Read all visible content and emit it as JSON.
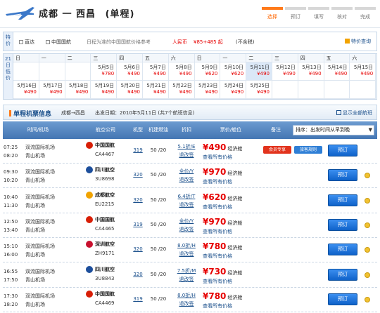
{
  "header": {
    "route": "成都 一 西昌",
    "trip_type": "(单程)",
    "steps": [
      "选择",
      "预订",
      "填写",
      "核对",
      "完成"
    ]
  },
  "filter": {
    "side_label": "特价",
    "direct": "直达",
    "airline": "中国国航",
    "hint": "日程为准的中国国航价格参考",
    "price_label": "人民币",
    "price_value": "¥85+485 起",
    "tax_note": "(不含税)",
    "calendar_link": "特价查询"
  },
  "calendar": {
    "side_label": "21日低价",
    "weekdays": [
      "日",
      "一",
      "二",
      "三",
      "四",
      "五",
      "六",
      "日",
      "一",
      "二",
      "三",
      "四",
      "五",
      "六"
    ],
    "row1": [
      {
        "date": "",
        "price": ""
      },
      {
        "date": "",
        "price": ""
      },
      {
        "date": "",
        "price": ""
      },
      {
        "date": "5月5日",
        "price": "¥780"
      },
      {
        "date": "5月6日",
        "price": "¥490"
      },
      {
        "date": "5月7日",
        "price": "¥490"
      },
      {
        "date": "5月8日",
        "price": "¥490"
      },
      {
        "date": "5月9日",
        "price": "¥620"
      },
      {
        "date": "5月10日",
        "price": "¥620"
      },
      {
        "date": "5月11日",
        "price": "¥490"
      },
      {
        "date": "5月12日",
        "price": "¥490"
      },
      {
        "date": "5月13日",
        "price": "¥490"
      },
      {
        "date": "5月14日",
        "price": "¥490"
      },
      {
        "date": "5月15日",
        "price": "¥490"
      }
    ],
    "row2": [
      {
        "date": "5月16日",
        "price": "¥490"
      },
      {
        "date": "5月17日",
        "price": "¥490"
      },
      {
        "date": "5月18日",
        "price": "¥490"
      },
      {
        "date": "5月19日",
        "price": "¥490"
      },
      {
        "date": "5月20日",
        "price": "¥490"
      },
      {
        "date": "5月21日",
        "price": "¥490"
      },
      {
        "date": "5月22日",
        "price": "¥490"
      },
      {
        "date": "5月23日",
        "price": "¥490"
      },
      {
        "date": "5月24日",
        "price": "¥490"
      },
      {
        "date": "5月25日",
        "price": "¥490"
      },
      {
        "date": "",
        "price": ""
      },
      {
        "date": "",
        "price": ""
      },
      {
        "date": "",
        "price": ""
      },
      {
        "date": "",
        "price": ""
      }
    ]
  },
  "info": {
    "title": "单程机票信息",
    "route": "成都→西昌",
    "date": "出发日期：2010年5月11日 (共7个航班信息)",
    "show_all": "显示全部航班"
  },
  "table": {
    "headers": [
      "时间/机场",
      "航空公司",
      "机型",
      "机建燃油",
      "折扣",
      "票价/舱位",
      "备注"
    ],
    "sort_label": "排序：出发时间从早到晚",
    "rows": [
      {
        "dep": "07:25",
        "arr": "08:20",
        "from": "双流国际机场",
        "to": "青山机场",
        "airline": "中国国航",
        "code": "CA4467",
        "logo": "#d81e06",
        "model": "319",
        "tax": "50 /20",
        "disc1": "5.1折/E",
        "disc2": "退改签",
        "price": "¥490",
        "cabin": "经济舱",
        "more": "查看所有价格",
        "tag1": "会员专享",
        "tag2": "旅客规则",
        "book": "预订"
      },
      {
        "dep": "09:30",
        "arr": "10:20",
        "from": "双流国际机场",
        "to": "青山机场",
        "airline": "四川航空",
        "code": "3U8698",
        "logo": "#1d4f9c",
        "model": "320",
        "tax": "50 /20",
        "disc1": "全价/Y",
        "disc2": "退改签",
        "price": "¥970",
        "cabin": "经济舱",
        "more": "查看所有价格",
        "tag1": "",
        "tag2": "",
        "book": "预订"
      },
      {
        "dep": "10:40",
        "arr": "11:30",
        "from": "双流国际机场",
        "to": "青山机场",
        "airline": "成都航空",
        "code": "EU2215",
        "logo": "#f1a300",
        "model": "320",
        "tax": "50 /20",
        "disc1": "6.4折/T",
        "disc2": "退改签",
        "price": "¥620",
        "cabin": "经济舱",
        "more": "查看所有价格",
        "tag1": "",
        "tag2": "",
        "book": "预订"
      },
      {
        "dep": "12:50",
        "arr": "13:40",
        "from": "双流国际机场",
        "to": "青山机场",
        "airline": "中国国航",
        "code": "CA4465",
        "logo": "#d81e06",
        "model": "319",
        "tax": "50 /20",
        "disc1": "全价/Y",
        "disc2": "退改签",
        "price": "¥970",
        "cabin": "经济舱",
        "more": "查看所有价格",
        "tag1": "",
        "tag2": "",
        "book": "预订"
      },
      {
        "dep": "15:10",
        "arr": "16:00",
        "from": "双流国际机场",
        "to": "青山机场",
        "airline": "深圳航空",
        "code": "ZH9171",
        "logo": "#c8102e",
        "model": "320",
        "tax": "50 /20",
        "disc1": "8.0折/H",
        "disc2": "退改签",
        "price": "¥780",
        "cabin": "经济舱",
        "more": "查看所有价格",
        "tag1": "",
        "tag2": "",
        "book": "预订"
      },
      {
        "dep": "16:55",
        "arr": "17:50",
        "from": "双流国际机场",
        "to": "青山机场",
        "airline": "四川航空",
        "code": "3U8843",
        "logo": "#1d4f9c",
        "model": "320",
        "tax": "50 /20",
        "disc1": "7.5折/M",
        "disc2": "退改签",
        "price": "¥730",
        "cabin": "经济舱",
        "more": "查看所有价格",
        "tag1": "",
        "tag2": "",
        "book": "预订"
      },
      {
        "dep": "17:30",
        "arr": "18:20",
        "from": "双流国际机场",
        "to": "青山机场",
        "airline": "中国国航",
        "code": "CA4469",
        "logo": "#d81e06",
        "model": "319",
        "tax": "50 /20",
        "disc1": "8.0折/H",
        "disc2": "退改签",
        "price": "¥780",
        "cabin": "经济舱",
        "more": "查看所有价格",
        "tag1": "",
        "tag2": "",
        "book": "预订"
      }
    ]
  }
}
